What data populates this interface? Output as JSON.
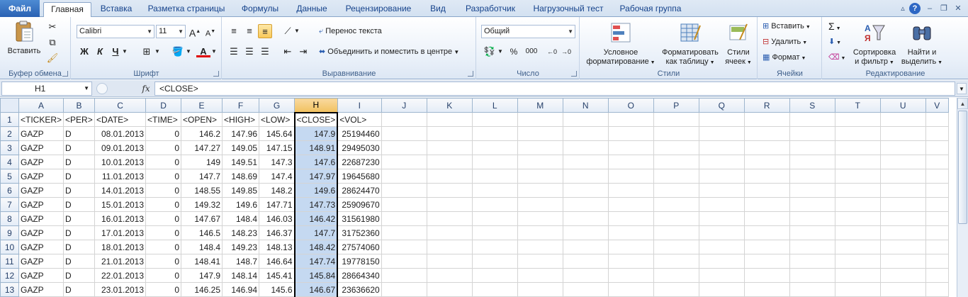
{
  "tabs": [
    "Файл",
    "Главная",
    "Вставка",
    "Разметка страницы",
    "Формулы",
    "Данные",
    "Рецензирование",
    "Вид",
    "Разработчик",
    "Нагрузочный тест",
    "Рабочая группа"
  ],
  "ribbon": {
    "clipboard": {
      "label": "Буфер обмена",
      "paste": "Вставить"
    },
    "font": {
      "label": "Шрифт",
      "name": "Calibri",
      "size": "11",
      "bold": "Ж",
      "italic": "К",
      "underline": "Ч"
    },
    "alignment": {
      "label": "Выравнивание",
      "wrap": "Перенос текста",
      "merge": "Объединить и поместить в центре"
    },
    "number": {
      "label": "Число",
      "format": "Общий",
      "percent": "%",
      "thousands": "000"
    },
    "styles": {
      "label": "Стили",
      "conditional_l1": "Условное",
      "conditional_l2": "форматирование",
      "table_l1": "Форматировать",
      "table_l2": "как таблицу",
      "cell_l1": "Стили",
      "cell_l2": "ячеек"
    },
    "cells": {
      "label": "Ячейки",
      "insert": "Вставить",
      "delete": "Удалить",
      "format": "Формат"
    },
    "editing": {
      "label": "Редактирование",
      "sum": "Σ",
      "sort_l1": "Сортировка",
      "sort_l2": "и фильтр",
      "find_l1": "Найти и",
      "find_l2": "выделить"
    }
  },
  "formula_bar": {
    "name_box": "H1",
    "fx": "fx",
    "content": "<CLOSE>"
  },
  "sheet": {
    "columns": [
      "A",
      "B",
      "C",
      "D",
      "E",
      "F",
      "G",
      "H",
      "I",
      "J",
      "K",
      "L",
      "M",
      "N",
      "O",
      "P",
      "Q",
      "R",
      "S",
      "T",
      "U",
      "V"
    ],
    "selected_column": "H",
    "header_row": [
      "<TICKER>",
      "<PER>",
      "<DATE>",
      "<TIME>",
      "<OPEN>",
      "<HIGH>",
      "<LOW>",
      "<CLOSE>",
      "<VOL>"
    ],
    "rows": [
      [
        "GAZP",
        "D",
        "08.01.2013",
        "0",
        "146.2",
        "147.96",
        "145.64",
        "147.9",
        "25194460"
      ],
      [
        "GAZP",
        "D",
        "09.01.2013",
        "0",
        "147.27",
        "149.05",
        "147.15",
        "148.91",
        "29495030"
      ],
      [
        "GAZP",
        "D",
        "10.01.2013",
        "0",
        "149",
        "149.51",
        "147.3",
        "147.6",
        "22687230"
      ],
      [
        "GAZP",
        "D",
        "11.01.2013",
        "0",
        "147.7",
        "148.69",
        "147.4",
        "147.97",
        "19645680"
      ],
      [
        "GAZP",
        "D",
        "14.01.2013",
        "0",
        "148.55",
        "149.85",
        "148.2",
        "149.6",
        "28624470"
      ],
      [
        "GAZP",
        "D",
        "15.01.2013",
        "0",
        "149.32",
        "149.6",
        "147.71",
        "147.73",
        "25909670"
      ],
      [
        "GAZP",
        "D",
        "16.01.2013",
        "0",
        "147.67",
        "148.4",
        "146.03",
        "146.42",
        "31561980"
      ],
      [
        "GAZP",
        "D",
        "17.01.2013",
        "0",
        "146.5",
        "148.23",
        "146.37",
        "147.7",
        "31752360"
      ],
      [
        "GAZP",
        "D",
        "18.01.2013",
        "0",
        "148.4",
        "149.23",
        "148.13",
        "148.42",
        "27574060"
      ],
      [
        "GAZP",
        "D",
        "21.01.2013",
        "0",
        "148.41",
        "148.7",
        "146.64",
        "147.74",
        "19778150"
      ],
      [
        "GAZP",
        "D",
        "22.01.2013",
        "0",
        "147.9",
        "148.14",
        "145.41",
        "145.84",
        "28664340"
      ],
      [
        "GAZP",
        "D",
        "23.01.2013",
        "0",
        "146.25",
        "146.94",
        "145.6",
        "146.67",
        "23636620"
      ]
    ]
  }
}
